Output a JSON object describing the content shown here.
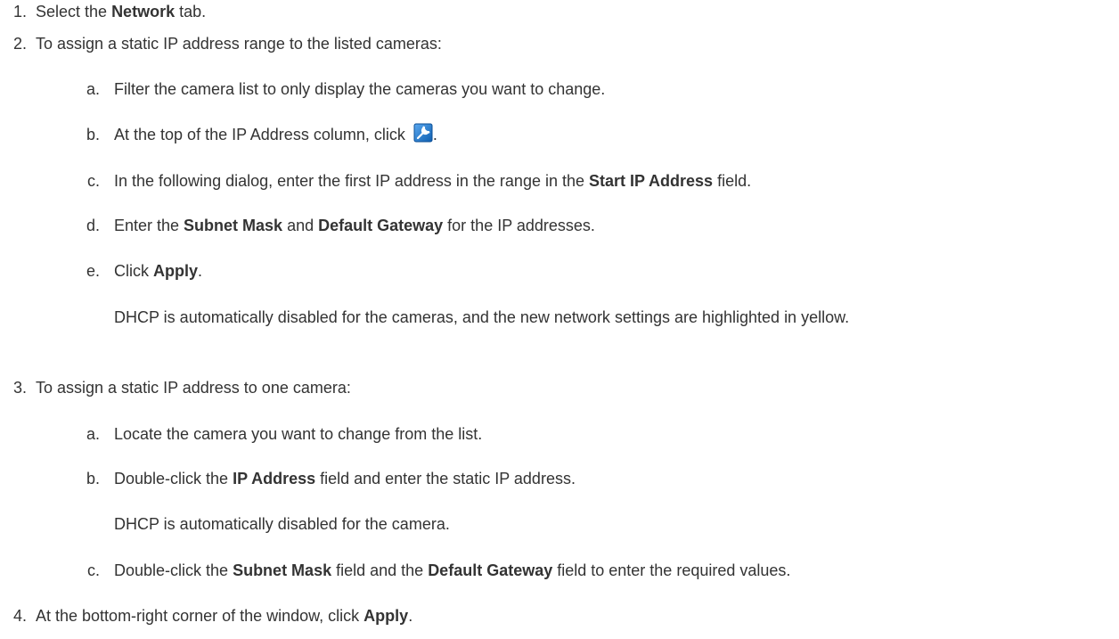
{
  "steps": [
    {
      "num": "1.",
      "pre": "Select the ",
      "bold1": "Network",
      "post": " tab."
    },
    {
      "num": "2.",
      "text": "To assign a static IP address range to the listed cameras:",
      "substeps": [
        {
          "letter": "a.",
          "text": "Filter the camera list to only display the cameras you want to change."
        },
        {
          "letter": "b.",
          "pre": "At the top of the IP Address column, click ",
          "icon": "wrench-tool-icon",
          "post": "."
        },
        {
          "letter": "c.",
          "pre": "In the following dialog, enter the first IP address in the range in the ",
          "bold1": "Start IP Address",
          "post": " field."
        },
        {
          "letter": "d.",
          "pre": "Enter the ",
          "bold1": "Subnet Mask",
          "mid": " and ",
          "bold2": "Default Gateway",
          "post": " for the IP addresses."
        },
        {
          "letter": "e.",
          "pre": "Click ",
          "bold1": "Apply",
          "post": ".",
          "note": "DHCP is automatically disabled for the cameras, and the new network settings are highlighted in yellow."
        }
      ]
    },
    {
      "num": "3.",
      "text": "To assign a static IP address to one camera:",
      "substeps": [
        {
          "letter": "a.",
          "text": "Locate the camera you want to change from the list."
        },
        {
          "letter": "b.",
          "pre": "Double-click the ",
          "bold1": "IP Address",
          "post": " field and enter the static IP address.",
          "note": "DHCP is automatically disabled for the camera."
        },
        {
          "letter": "c.",
          "pre": "Double-click the ",
          "bold1": "Subnet Mask",
          "mid": " field and the ",
          "bold2": "Default Gateway",
          "post": " field to enter the required values."
        }
      ]
    },
    {
      "num": "4.",
      "pre": "At the bottom-right corner of the window, click ",
      "bold1": "Apply",
      "post": "."
    }
  ],
  "colors": {
    "text": "#333333",
    "icon_blue": "#1a6fc4",
    "icon_light": "#ffffff"
  }
}
